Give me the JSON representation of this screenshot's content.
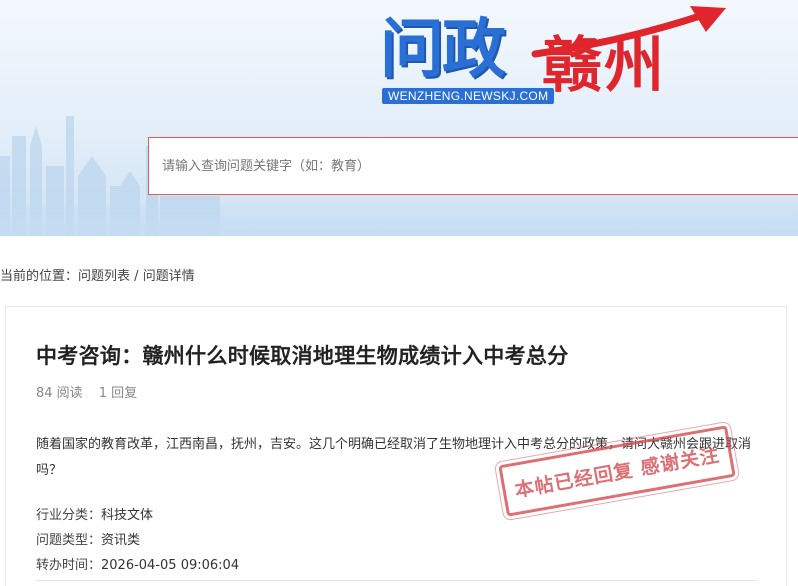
{
  "banner": {
    "logo_main": "问政",
    "logo_city": "赣州",
    "logo_url": "WENZHENG.NEWSKJ.COM"
  },
  "search": {
    "placeholder": "请输入查询问题关键字（如：教育）",
    "value": ""
  },
  "breadcrumb": {
    "prefix": "当前的位置：",
    "items": [
      "问题列表",
      "问题详情"
    ],
    "separator": " / "
  },
  "post": {
    "title": "中考咨询：赣州什么时候取消地理生物成绩计入中考总分",
    "reads": "84 阅读",
    "replies": "1 回复",
    "body": "随着国家的教育改革，江西南昌，抚州，吉安。这几个明确已经取消了生物地理计入中考总分的政策，请问大赣州会跟进取消吗？",
    "info": [
      {
        "label": "行业分类：",
        "value": "科技文体"
      },
      {
        "label": "问题类型：",
        "value": "资讯类"
      },
      {
        "label": "转办时间：",
        "value": "2026-04-05 09:06:04"
      }
    ],
    "stamp": "本帖已经回复 感谢关注"
  },
  "colors": {
    "brand_blue": "#2a6fd6",
    "brand_red": "#e0262c",
    "stamp_red": "#d4494f",
    "search_border": "#e25a5a"
  },
  "icons": {
    "skyline": "city-skyline-illustration",
    "swoosh": "red-arrow-swoosh"
  }
}
